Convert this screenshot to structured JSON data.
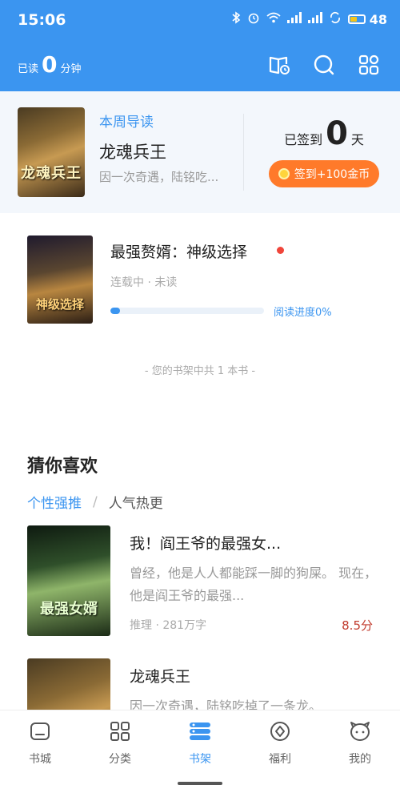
{
  "status_bar": {
    "time": "15:06",
    "battery_percent": "48",
    "battery_level": 0.48
  },
  "header": {
    "read_prefix": "已读",
    "read_minutes": "0",
    "read_suffix": "分钟",
    "icons": [
      "bookshelf-manage-icon",
      "search-icon",
      "grid-menu-icon"
    ]
  },
  "guide": {
    "tag": "本周导读",
    "book_title": "龙魂兵王",
    "book_desc": "因一次奇遇，陆铭吃...",
    "cover_text": "龙魂兵王",
    "signin_prefix": "已签到",
    "signin_days": "0",
    "signin_suffix": "天",
    "signin_button": "签到+100金币"
  },
  "shelf_book": {
    "title": "最强赘婿：神级选择",
    "status": "连载中 · 未读",
    "progress_label": "阅读进度0%",
    "progress": 0.06,
    "cover_text": "神级选择"
  },
  "shelf_count": "- 您的书架中共 1 本书 -",
  "recommend": {
    "title": "猜你喜欢",
    "tabs": {
      "active": "个性强推",
      "separator": "/",
      "inactive": "人气热更"
    },
    "items": [
      {
        "title": "我！阎王爷的最强女...",
        "desc": "曾经，他是人人都能踩一脚的狗屎。     现在，他是阎王爷的最强...",
        "meta": "推理 · 281万字",
        "score": "8.5分",
        "cover_text": "最强女婿"
      },
      {
        "title": "龙魂兵王",
        "desc": "因一次奇遇，陆铭吃掉了一条龙。",
        "meta": "",
        "score": "",
        "cover_text": ""
      }
    ]
  },
  "nav": {
    "items": [
      {
        "label": "书城",
        "icon": "bookstore-icon"
      },
      {
        "label": "分类",
        "icon": "category-icon"
      },
      {
        "label": "书架",
        "icon": "bookshelf-icon"
      },
      {
        "label": "福利",
        "icon": "welfare-icon"
      },
      {
        "label": "我的",
        "icon": "profile-icon"
      }
    ],
    "active_index": 2
  },
  "colors": {
    "brand": "#3b95f0",
    "signin_button": "#ff7a2a",
    "score": "#c0392b",
    "unread_dot": "#f0453a"
  }
}
